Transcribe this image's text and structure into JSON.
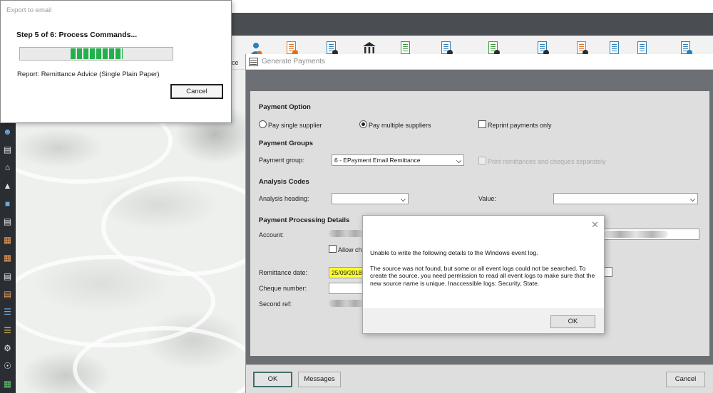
{
  "export_dialog": {
    "title": "Export to email",
    "step_text": "Step 5 of 6: Process Commands...",
    "progress_fraction": 0.34,
    "report_text": "Report: Remittance Advice (Single Plain Paper)",
    "cancel_label": "Cancel"
  },
  "toolbar": {
    "partial_label": "ce",
    "icons": [
      "person-icon",
      "document-gear-icon",
      "document-user-icon",
      "bank-icon",
      "document-list-icon",
      "document-gear-icon",
      "document-gear-icon",
      "document-gear-icon",
      "document-gear-icon",
      "document-list-icon",
      "document-list-icon",
      "document-export-icon"
    ]
  },
  "left_strip": {
    "icons": [
      "person-icon",
      "book-icon",
      "bank-icon",
      "hierarchy-icon",
      "document-icon",
      "document-icon",
      "report-icon",
      "report-icon",
      "document-icon",
      "document-icon",
      "stack-icon",
      "stack-icon",
      "gear-icon",
      "globe-icon",
      "spreadsheet-icon"
    ]
  },
  "generate_payments": {
    "title": "Generate Payments",
    "payment_option": {
      "heading": "Payment Option",
      "single_label": "Pay single supplier",
      "multiple_label": "Pay multiple suppliers",
      "reprint_label": "Reprint payments only",
      "selected": "multiple"
    },
    "payment_groups": {
      "heading": "Payment Groups",
      "group_label": "Payment group:",
      "group_value": "6 - EPayment Email Remittance",
      "print_separately_label": "Print remittances and cheques separately"
    },
    "analysis_codes": {
      "heading": "Analysis Codes",
      "heading_label": "Analysis heading:",
      "heading_value": "",
      "value_label": "Value:",
      "value_value": ""
    },
    "processing": {
      "heading": "Payment Processing Details",
      "account_label": "Account:",
      "allow_label": "Allow ch",
      "remittance_date_label": "Remittance date:",
      "remittance_date_value": "25/09/2018",
      "cheque_number_label": "Cheque number:",
      "second_ref_label": "Second ref:"
    },
    "footer": {
      "ok_label": "OK",
      "messages_label": "Messages",
      "cancel_label": "Cancel"
    }
  },
  "error_dialog": {
    "line1": "Unable to write the following details to the Windows event log.",
    "line2": "The source was not found, but some or all event logs could not be searched.  To create the source, you need permission to read all event logs to make sure that the new source name is unique.  Inaccessible logs: Security, State.",
    "ok_label": "OK"
  }
}
